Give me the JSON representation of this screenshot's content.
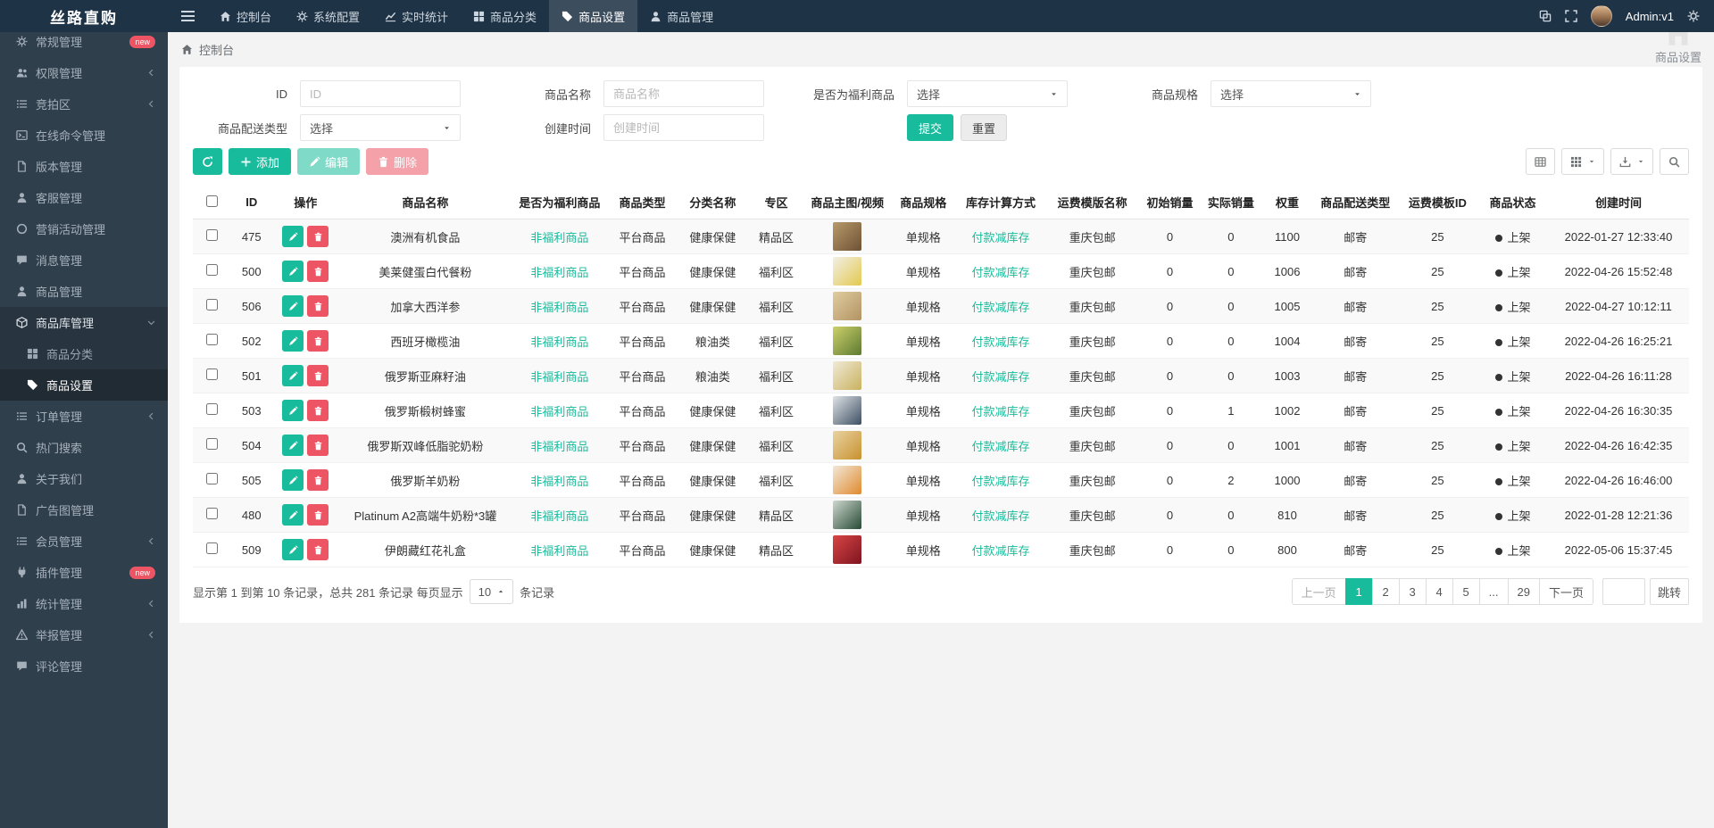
{
  "brand": "丝路直购",
  "colors": {
    "accent": "#18bc9c",
    "danger": "#ed5565",
    "navbar": "#1f3346",
    "sidebar": "#2f3f4c"
  },
  "topnav": {
    "items": [
      {
        "key": "console",
        "label": "控制台",
        "icon": "home",
        "active": false
      },
      {
        "key": "system-config",
        "label": "系统配置",
        "icon": "gear",
        "active": false
      },
      {
        "key": "realtime-stats",
        "label": "实时统计",
        "icon": "chart",
        "active": false
      },
      {
        "key": "product-category",
        "label": "商品分类",
        "icon": "grid",
        "active": false
      },
      {
        "key": "product-settings",
        "label": "商品设置",
        "icon": "tag",
        "active": true
      },
      {
        "key": "product-management",
        "label": "商品管理",
        "icon": "user",
        "active": false
      }
    ],
    "admin_label": "Admin:v1"
  },
  "sidebar": {
    "items": [
      {
        "key": "general",
        "label": "常规管理",
        "icon": "gear",
        "badge": "new"
      },
      {
        "key": "auth",
        "label": "权限管理",
        "icon": "users",
        "chevron": true
      },
      {
        "key": "auction",
        "label": "竞拍区",
        "icon": "list",
        "chevron": true
      },
      {
        "key": "online-command",
        "label": "在线命令管理",
        "icon": "terminal"
      },
      {
        "key": "version",
        "label": "版本管理",
        "icon": "file"
      },
      {
        "key": "customer-service",
        "label": "客服管理",
        "icon": "user"
      },
      {
        "key": "marketing",
        "label": "营销活动管理",
        "icon": "circle"
      },
      {
        "key": "message",
        "label": "消息管理",
        "icon": "comment"
      },
      {
        "key": "product",
        "label": "商品管理",
        "icon": "user"
      },
      {
        "key": "product-store",
        "label": "商品库管理",
        "icon": "cube",
        "expanded": true,
        "children": [
          {
            "key": "product-category",
            "label": "商品分类",
            "icon": "grid",
            "active": false
          },
          {
            "key": "product-settings",
            "label": "商品设置",
            "icon": "tag",
            "active": true
          }
        ]
      },
      {
        "key": "order",
        "label": "订单管理",
        "icon": "list",
        "chevron": true
      },
      {
        "key": "hot-search",
        "label": "热门搜索",
        "icon": "search"
      },
      {
        "key": "about-us",
        "label": "关于我们",
        "icon": "user"
      },
      {
        "key": "ad-image",
        "label": "广告图管理",
        "icon": "file"
      },
      {
        "key": "member",
        "label": "会员管理",
        "icon": "list",
        "chevron": true
      },
      {
        "key": "addon",
        "label": "插件管理",
        "icon": "plug",
        "badge": "new"
      },
      {
        "key": "stats",
        "label": "统计管理",
        "icon": "bars",
        "chevron": true
      },
      {
        "key": "report",
        "label": "举报管理",
        "icon": "warning",
        "chevron": true
      },
      {
        "key": "comment",
        "label": "评论管理",
        "icon": "comment"
      }
    ]
  },
  "breadcrumb": {
    "left": "控制台",
    "right": "商品设置"
  },
  "filters": {
    "id": {
      "label": "ID",
      "placeholder": "ID"
    },
    "name": {
      "label": "商品名称",
      "placeholder": "商品名称"
    },
    "welfare": {
      "label": "是否为福利商品",
      "value": "选择"
    },
    "spec": {
      "label": "商品规格",
      "value": "选择"
    },
    "delivery": {
      "label": "商品配送类型",
      "value": "选择"
    },
    "created": {
      "label": "创建时间",
      "placeholder": "创建时间"
    },
    "submit": "提交",
    "reset": "重置"
  },
  "toolbar": {
    "add": "添加",
    "edit": "编辑",
    "delete": "删除"
  },
  "table": {
    "columns": [
      "ID",
      "操作",
      "商品名称",
      "是否为福利商品",
      "商品类型",
      "分类名称",
      "专区",
      "商品主图/视频",
      "商品规格",
      "库存计算方式",
      "运费模版名称",
      "初始销量",
      "实际销量",
      "权重",
      "商品配送类型",
      "运费模板ID",
      "商品状态",
      "创建时间"
    ],
    "rows": [
      {
        "id": 475,
        "name": "澳洲有机食品",
        "welfare": "非福利商品",
        "type": "平台商品",
        "category": "健康保健",
        "zone": "精品区",
        "thumb": [
          "#b89a6a",
          "#6e5134"
        ],
        "spec": "单规格",
        "stock_mode": "付款减库存",
        "freight_tpl": "重庆包邮",
        "init_sales": 0,
        "real_sales": 0,
        "weight": 1100,
        "delivery": "邮寄",
        "freight_id": 25,
        "status": "上架",
        "created": "2022-01-27 12:33:40"
      },
      {
        "id": 500,
        "name": "美莱健蛋白代餐粉",
        "welfare": "非福利商品",
        "type": "平台商品",
        "category": "健康保健",
        "zone": "福利区",
        "thumb": [
          "#f2efe6",
          "#e3c94f"
        ],
        "spec": "单规格",
        "stock_mode": "付款减库存",
        "freight_tpl": "重庆包邮",
        "init_sales": 0,
        "real_sales": 0,
        "weight": 1006,
        "delivery": "邮寄",
        "freight_id": 25,
        "status": "上架",
        "created": "2022-04-26 15:52:48"
      },
      {
        "id": 506,
        "name": "加拿大西洋参",
        "welfare": "非福利商品",
        "type": "平台商品",
        "category": "健康保健",
        "zone": "福利区",
        "thumb": [
          "#e0cda0",
          "#b39363"
        ],
        "spec": "单规格",
        "stock_mode": "付款减库存",
        "freight_tpl": "重庆包邮",
        "init_sales": 0,
        "real_sales": 0,
        "weight": 1005,
        "delivery": "邮寄",
        "freight_id": 25,
        "status": "上架",
        "created": "2022-04-27 10:12:11"
      },
      {
        "id": 502,
        "name": "西班牙橄榄油",
        "welfare": "非福利商品",
        "type": "平台商品",
        "category": "粮油类",
        "zone": "福利区",
        "thumb": [
          "#cdd06a",
          "#5d7a33"
        ],
        "spec": "单规格",
        "stock_mode": "付款减库存",
        "freight_tpl": "重庆包邮",
        "init_sales": 0,
        "real_sales": 0,
        "weight": 1004,
        "delivery": "邮寄",
        "freight_id": 25,
        "status": "上架",
        "created": "2022-04-26 16:25:21"
      },
      {
        "id": 501,
        "name": "俄罗斯亚麻籽油",
        "welfare": "非福利商品",
        "type": "平台商品",
        "category": "粮油类",
        "zone": "福利区",
        "thumb": [
          "#f0ead8",
          "#c9b25e"
        ],
        "spec": "单规格",
        "stock_mode": "付款减库存",
        "freight_tpl": "重庆包邮",
        "init_sales": 0,
        "real_sales": 0,
        "weight": 1003,
        "delivery": "邮寄",
        "freight_id": 25,
        "status": "上架",
        "created": "2022-04-26 16:11:28"
      },
      {
        "id": 503,
        "name": "俄罗斯椴树蜂蜜",
        "welfare": "非福利商品",
        "type": "平台商品",
        "category": "健康保健",
        "zone": "福利区",
        "thumb": [
          "#dfe3e6",
          "#3d4f63"
        ],
        "spec": "单规格",
        "stock_mode": "付款减库存",
        "freight_tpl": "重庆包邮",
        "init_sales": 0,
        "real_sales": 1,
        "weight": 1002,
        "delivery": "邮寄",
        "freight_id": 25,
        "status": "上架",
        "created": "2022-04-26 16:30:35"
      },
      {
        "id": 504,
        "name": "俄罗斯双峰低脂驼奶粉",
        "welfare": "非福利商品",
        "type": "平台商品",
        "category": "健康保健",
        "zone": "福利区",
        "thumb": [
          "#e8d3a2",
          "#c9912f"
        ],
        "spec": "单规格",
        "stock_mode": "付款减库存",
        "freight_tpl": "重庆包邮",
        "init_sales": 0,
        "real_sales": 0,
        "weight": 1001,
        "delivery": "邮寄",
        "freight_id": 25,
        "status": "上架",
        "created": "2022-04-26 16:42:35"
      },
      {
        "id": 505,
        "name": "俄罗斯羊奶粉",
        "welfare": "非福利商品",
        "type": "平台商品",
        "category": "健康保健",
        "zone": "福利区",
        "thumb": [
          "#f2e8d8",
          "#e08a2e"
        ],
        "spec": "单规格",
        "stock_mode": "付款减库存",
        "freight_tpl": "重庆包邮",
        "init_sales": 0,
        "real_sales": 2,
        "weight": 1000,
        "delivery": "邮寄",
        "freight_id": 25,
        "status": "上架",
        "created": "2022-04-26 16:46:00"
      },
      {
        "id": 480,
        "name": "Platinum A2高端牛奶粉*3罐",
        "welfare": "非福利商品",
        "type": "平台商品",
        "category": "健康保健",
        "zone": "精品区",
        "thumb": [
          "#cfd8cf",
          "#274a35"
        ],
        "spec": "单规格",
        "stock_mode": "付款减库存",
        "freight_tpl": "重庆包邮",
        "init_sales": 0,
        "real_sales": 0,
        "weight": 810,
        "delivery": "邮寄",
        "freight_id": 25,
        "status": "上架",
        "created": "2022-01-28 12:21:36"
      },
      {
        "id": 509,
        "name": "伊朗藏红花礼盒",
        "welfare": "非福利商品",
        "type": "平台商品",
        "category": "健康保健",
        "zone": "精品区",
        "thumb": [
          "#d94545",
          "#7e1420"
        ],
        "spec": "单规格",
        "stock_mode": "付款减库存",
        "freight_tpl": "重庆包邮",
        "init_sales": 0,
        "real_sales": 0,
        "weight": 800,
        "delivery": "邮寄",
        "freight_id": 25,
        "status": "上架",
        "created": "2022-05-06 15:37:45"
      }
    ]
  },
  "footer": {
    "summary_prefix": "显示第 1 到第 10 条记录，总共 281 条记录 每页显示",
    "page_size": "10",
    "summary_suffix": "条记录"
  },
  "pagination": {
    "prev": "上一页",
    "pages": [
      "1",
      "2",
      "3",
      "4",
      "5"
    ],
    "current": "1",
    "ellipsis": "...",
    "last": "29",
    "next": "下一页",
    "jump": "跳转"
  }
}
